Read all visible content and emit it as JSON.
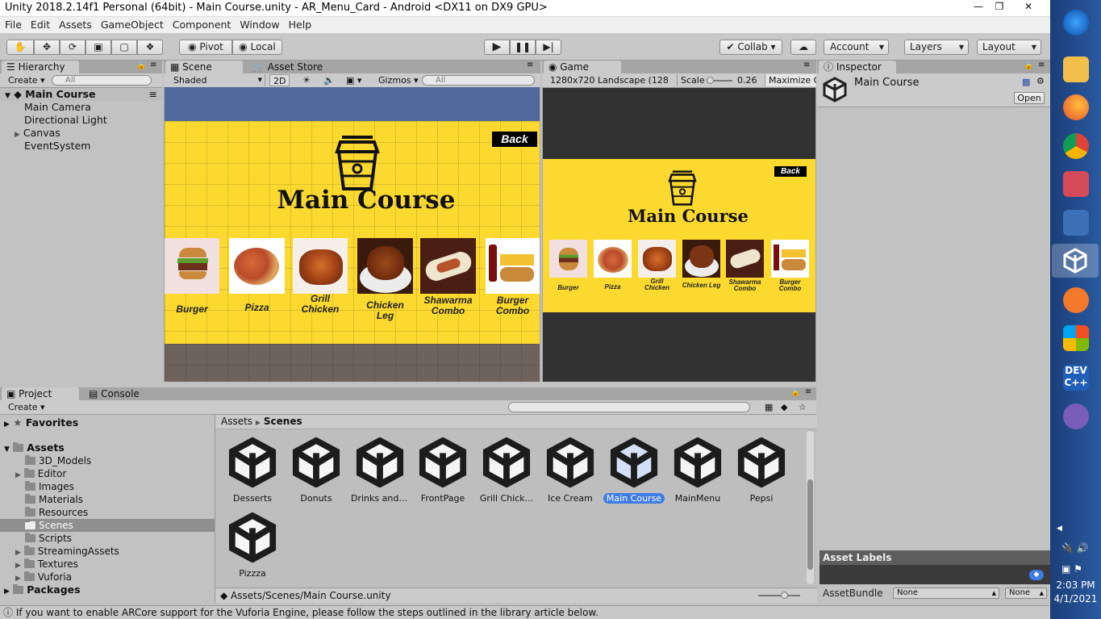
{
  "window": {
    "title": "Unity 2018.2.14f1 Personal (64bit) - Main Course.unity - AR_Menu_Card - Android <DX11 on DX9 GPU>"
  },
  "menu": [
    "File",
    "Edit",
    "Assets",
    "GameObject",
    "Component",
    "Window",
    "Help"
  ],
  "toolbar": {
    "pivot": "Pivot",
    "local": "Local",
    "collab": "Collab ▾",
    "account": "Account",
    "layers": "Layers",
    "layout": "Layout"
  },
  "hierarchy": {
    "tab": "Hierarchy",
    "create": "Create ▾",
    "search_placeholder": "All",
    "scene": "Main Course",
    "items": [
      "Main Camera",
      "Directional Light",
      "Canvas",
      "EventSystem"
    ]
  },
  "scene": {
    "tab": "Scene",
    "tab2": "Asset Store",
    "shading": "Shaded",
    "mode2d": "2D",
    "gizmos": "Gizmos ▾",
    "search_placeholder": "All",
    "heading": "Main Course",
    "back": "Back",
    "items": [
      {
        "label1": "Burger",
        "label2": ""
      },
      {
        "label1": "Pizza",
        "label2": ""
      },
      {
        "label1": "Grill",
        "label2": "Chicken"
      },
      {
        "label1": "Chicken Leg",
        "label2": ""
      },
      {
        "label1": "Shawarma",
        "label2": "Combo"
      },
      {
        "label1": "Burger",
        "label2": "Combo"
      }
    ]
  },
  "game": {
    "tab": "Game",
    "resolution": "1280x720 Landscape (128 ",
    "scale_label": "Scale",
    "scale_value": "0.26",
    "maximize": "Maximize O"
  },
  "inspector": {
    "tab": "Inspector",
    "name": "Main Course",
    "open": "Open",
    "asset_labels": "Asset Labels",
    "assetbundle": "AssetBundle",
    "bundle_value": "None",
    "variant_value": "None"
  },
  "project": {
    "tab": "Project",
    "tab2": "Console",
    "create": "Create ▾",
    "favorites": "Favorites",
    "assets": "Assets",
    "packages": "Packages",
    "folders": [
      "3D_Models",
      "Editor",
      "Images",
      "Materials",
      "Resources",
      "Scenes",
      "Scripts",
      "StreamingAssets",
      "Textures",
      "Vuforia"
    ],
    "breadcrumb_root": "Assets",
    "breadcrumb_current": "Scenes",
    "scenes": [
      "Desserts",
      "Donuts",
      "Drinks and ...",
      "FrontPage",
      "Grill Chick...",
      "Ice Cream",
      "Main Course",
      "MainMenu",
      "Pepsi",
      "Pizzza"
    ],
    "path": "Assets/Scenes/Main Course.unity"
  },
  "status": {
    "message": "If you want to enable ARCore support for the Vuforia Engine, please follow the steps outlined in the library article below."
  },
  "taskbar": {
    "time": "2:03 PM",
    "date": "4/1/2021"
  },
  "colors": {
    "menu_yellow": "#fcd92f",
    "selection_blue": "#3e7ce6",
    "unity_gray": "#c2c2c2"
  }
}
